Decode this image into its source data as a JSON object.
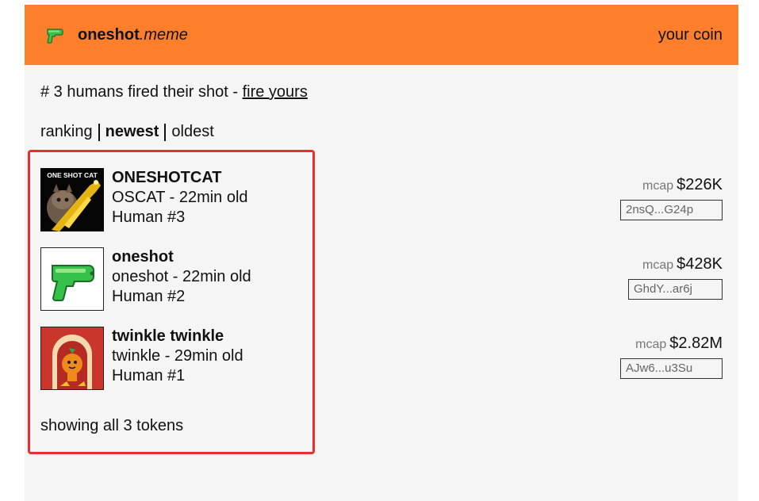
{
  "header": {
    "brand_name": "oneshot",
    "brand_tld": ".meme",
    "icon": "water-pistol-icon",
    "right_link": "your coin",
    "bg_color": "#fd7f2c"
  },
  "announcement": {
    "text": "# 3 humans fired their shot - ",
    "link": "fire yours"
  },
  "sort": {
    "options": [
      "ranking",
      "newest",
      "oldest"
    ],
    "active": "newest"
  },
  "tokens": [
    {
      "name": "ONESHOTCAT",
      "meta": "OSCAT - 22min old",
      "human": "Human #3",
      "mcap_label": "mcap",
      "mcap": "$226K",
      "address": "2nsQ...G24p",
      "thumb_text": "ONE SHOT CAT",
      "thumb_icon": "cat-with-gun-icon"
    },
    {
      "name": "oneshot",
      "meta": "oneshot - 22min old",
      "human": "Human #2",
      "mcap_label": "mcap",
      "mcap": "$428K",
      "address": "GhdY...ar6j",
      "thumb_icon": "water-pistol-icon"
    },
    {
      "name": "twinkle twinkle",
      "meta": "twinkle - 29min old",
      "human": "Human #1",
      "mcap_label": "mcap",
      "mcap": "$2.82M",
      "address": "AJw6...u3Su",
      "thumb_icon": "orange-character-icon"
    }
  ],
  "footer": {
    "showing": "showing all 3 tokens"
  },
  "colors": {
    "accent": "#fd7f2c",
    "highlight": "#e8302a",
    "page_bg": "#f5f5f5"
  }
}
